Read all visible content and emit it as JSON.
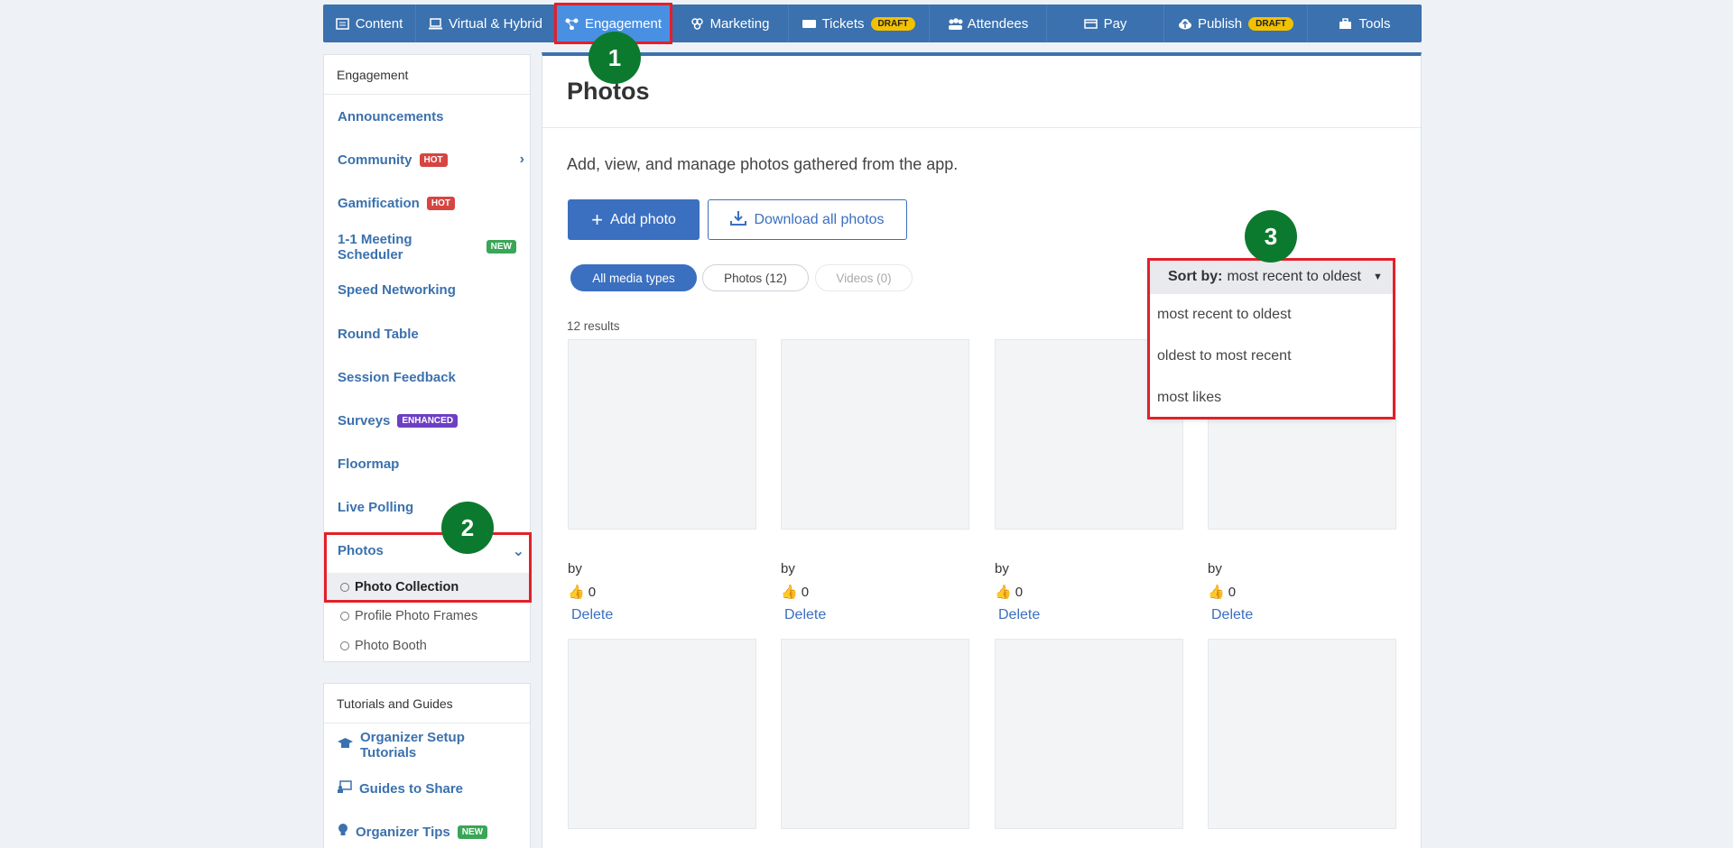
{
  "topnav": {
    "items": [
      {
        "label": "Content",
        "icon": "content-icon"
      },
      {
        "label": "Virtual & Hybrid",
        "icon": "laptop-icon"
      },
      {
        "label": "Engagement",
        "icon": "engagement-icon"
      },
      {
        "label": "Marketing",
        "icon": "marketing-icon"
      },
      {
        "label": "Tickets",
        "icon": "ticket-icon",
        "badge": "DRAFT"
      },
      {
        "label": "Attendees",
        "icon": "attendees-icon"
      },
      {
        "label": "Pay",
        "icon": "card-icon"
      },
      {
        "label": "Publish",
        "icon": "cloud-upload-icon",
        "badge": "DRAFT"
      },
      {
        "label": "Tools",
        "icon": "toolbox-icon"
      }
    ]
  },
  "sidebar": {
    "header": "Engagement",
    "items": [
      {
        "label": "Announcements"
      },
      {
        "label": "Community",
        "tag": "HOT"
      },
      {
        "label": "Gamification",
        "tag": "HOT"
      },
      {
        "label": "1-1 Meeting Scheduler",
        "tag": "NEW"
      },
      {
        "label": "Speed Networking"
      },
      {
        "label": "Round Table"
      },
      {
        "label": "Session Feedback"
      },
      {
        "label": "Surveys",
        "tag": "ENHANCED"
      },
      {
        "label": "Floormap"
      },
      {
        "label": "Live Polling"
      },
      {
        "label": "Photos"
      }
    ],
    "photo_sub": [
      "Photo Collection",
      "Profile Photo Frames",
      "Photo Booth"
    ]
  },
  "sidebar2": {
    "header": "Tutorials and Guides",
    "items": [
      {
        "label": "Organizer Setup Tutorials"
      },
      {
        "label": "Guides to Share"
      },
      {
        "label": "Organizer Tips",
        "tag": "NEW"
      }
    ]
  },
  "main": {
    "title": "Photos",
    "description": "Add, view, and manage photos gathered from the app.",
    "add_button": "Add photo",
    "download_button": "Download all photos",
    "filters": {
      "all": "All media types",
      "photos": "Photos (12)",
      "videos": "Videos (0)"
    },
    "results": "12 results",
    "photo_by": "by",
    "photo_likes": "0",
    "delete_label": "Delete"
  },
  "sort": {
    "label": "Sort by:",
    "value": "most recent to oldest",
    "options": [
      "most recent to oldest",
      "oldest to most recent",
      "most likes"
    ]
  },
  "markers": [
    "1",
    "2",
    "3"
  ],
  "colors": {
    "nav": "#3b71ae",
    "accent": "#3b6fc0",
    "marker": "#0c7a2e",
    "highlight": "#e2202a"
  }
}
